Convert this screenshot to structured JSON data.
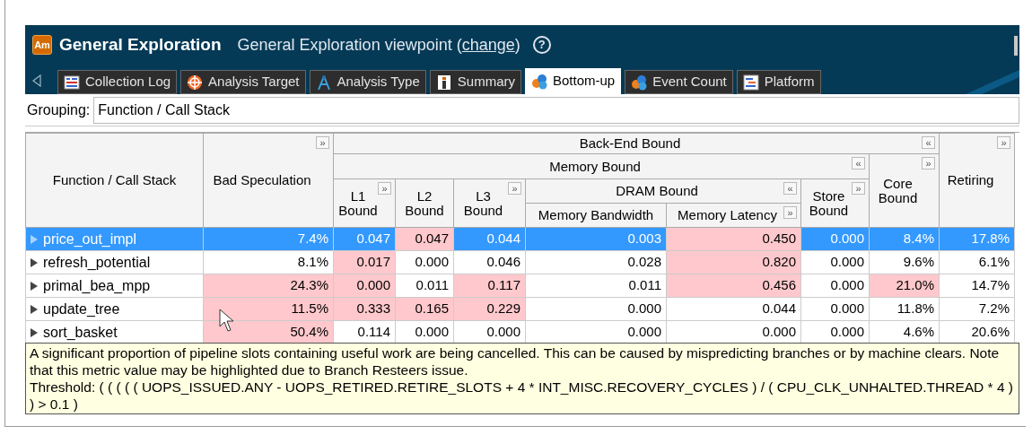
{
  "header": {
    "logo_text": "Am",
    "title": "General Exploration",
    "subtitle": "General Exploration viewpoint (",
    "link": "change",
    "subtitle_end": ")",
    "help": "?"
  },
  "tabs": [
    {
      "label": "Collection Log",
      "selected": false
    },
    {
      "label": "Analysis Target",
      "selected": false
    },
    {
      "label": "Analysis Type",
      "selected": false
    },
    {
      "label": "Summary",
      "selected": false
    },
    {
      "label": "Bottom-up",
      "selected": true
    },
    {
      "label": "Event Count",
      "selected": false
    },
    {
      "label": "Platform",
      "selected": false
    }
  ],
  "grouping": {
    "label": "Grouping:",
    "value": "Function / Call Stack"
  },
  "table": {
    "columns": [
      {
        "label": "Function / Call Stack"
      },
      {
        "label": "Bad Speculation",
        "toggle": "»"
      },
      {
        "label": "Back-End Bound",
        "toggle": "«",
        "colspan": 7,
        "children": [
          {
            "label": "Memory Bound",
            "toggle": "«",
            "colspan": 6,
            "children": [
              {
                "label": "L1 Bound",
                "toggle": "»"
              },
              {
                "label": "L2 Bound"
              },
              {
                "label": "L3 Bound",
                "toggle": "»"
              },
              {
                "label": "DRAM Bound",
                "toggle": "«",
                "colspan": 2,
                "children": [
                  {
                    "label": "Memory Bandwidth"
                  },
                  {
                    "label": "Memory Latency",
                    "toggle": "»"
                  }
                ]
              },
              {
                "label": "Store Bound",
                "toggle": "»"
              }
            ]
          },
          {
            "label": "Core Bound",
            "toggle": "»"
          }
        ]
      },
      {
        "label": "Retiring",
        "toggle": "»"
      }
    ],
    "rows": [
      {
        "selected": true,
        "cells": [
          {
            "value": "price_out_impl",
            "highlighted": false
          },
          {
            "value": "7.4%",
            "highlighted": false
          },
          {
            "value": "0.047",
            "highlighted": false
          },
          {
            "value": "0.047",
            "highlighted": true
          },
          {
            "value": "0.044",
            "highlighted": false
          },
          {
            "value": "0.003",
            "highlighted": false
          },
          {
            "value": "0.450",
            "highlighted": true
          },
          {
            "value": "0.000",
            "highlighted": false
          },
          {
            "value": "8.4%",
            "highlighted": false
          },
          {
            "value": "17.8%",
            "highlighted": false
          }
        ]
      },
      {
        "selected": false,
        "cells": [
          {
            "value": "refresh_potential",
            "highlighted": false
          },
          {
            "value": "8.1%",
            "highlighted": false
          },
          {
            "value": "0.017",
            "highlighted": true
          },
          {
            "value": "0.000",
            "highlighted": false
          },
          {
            "value": "0.046",
            "highlighted": false
          },
          {
            "value": "0.028",
            "highlighted": false
          },
          {
            "value": "0.820",
            "highlighted": true
          },
          {
            "value": "0.000",
            "highlighted": false
          },
          {
            "value": "9.6%",
            "highlighted": false
          },
          {
            "value": "6.1%",
            "highlighted": false
          }
        ]
      },
      {
        "selected": false,
        "cells": [
          {
            "value": "primal_bea_mpp",
            "highlighted": false
          },
          {
            "value": "24.3%",
            "highlighted": true
          },
          {
            "value": "0.000",
            "highlighted": true
          },
          {
            "value": "0.011",
            "highlighted": false
          },
          {
            "value": "0.117",
            "highlighted": true
          },
          {
            "value": "0.011",
            "highlighted": false
          },
          {
            "value": "0.456",
            "highlighted": true
          },
          {
            "value": "0.000",
            "highlighted": false
          },
          {
            "value": "21.0%",
            "highlighted": true
          },
          {
            "value": "14.7%",
            "highlighted": false
          }
        ]
      },
      {
        "selected": false,
        "cells": [
          {
            "value": "update_tree",
            "highlighted": false
          },
          {
            "value": "11.5%",
            "highlighted": true
          },
          {
            "value": "0.333",
            "highlighted": true
          },
          {
            "value": "0.165",
            "highlighted": true
          },
          {
            "value": "0.229",
            "highlighted": true
          },
          {
            "value": "0.000",
            "highlighted": false
          },
          {
            "value": "0.044",
            "highlighted": false
          },
          {
            "value": "0.000",
            "highlighted": false
          },
          {
            "value": "11.8%",
            "highlighted": false
          },
          {
            "value": "7.2%",
            "highlighted": false
          }
        ]
      },
      {
        "selected": false,
        "cells": [
          {
            "value": "sort_basket",
            "highlighted": false
          },
          {
            "value": "50.4%",
            "highlighted": true
          },
          {
            "value": "0.114",
            "highlighted": false
          },
          {
            "value": "0.000",
            "highlighted": false
          },
          {
            "value": "0.000",
            "highlighted": false
          },
          {
            "value": "0.000",
            "highlighted": false
          },
          {
            "value": "0.000",
            "highlighted": false
          },
          {
            "value": "0.000",
            "highlighted": false
          },
          {
            "value": "4.6%",
            "highlighted": false
          },
          {
            "value": "20.6%",
            "highlighted": false
          }
        ]
      }
    ]
  },
  "tooltip": {
    "description": "A significant proportion of pipeline slots containing useful work are being cancelled. This can be caused by mispredicting branches or by machine clears. Note that this metric value may be highlighted due to Branch Resteers issue.",
    "threshold": "Threshold: ( ( ( ( ( UOPS_ISSUED.ANY - UOPS_RETIRED.RETIRE_SLOTS + 4 * INT_MISC.RECOVERY_CYCLES ) / ( CPU_CLK_UNHALTED.THREAD * 4 ) ) > 0.1 )"
  }
}
